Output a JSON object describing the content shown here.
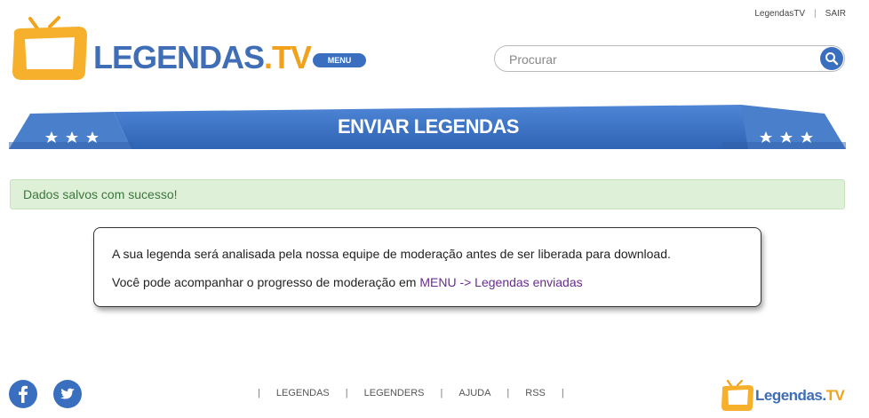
{
  "top_links": {
    "user": "LegendasTV",
    "logout": "SAIR"
  },
  "logo": {
    "main": "LEGENDAS",
    "dot": ".",
    "tv": "TV"
  },
  "menu_button": "MENU",
  "search": {
    "placeholder": "Procurar",
    "icon": "search-icon"
  },
  "banner": {
    "title": "ENVIAR LEGENDAS"
  },
  "alert": {
    "text": "Dados salvos com sucesso!"
  },
  "info": {
    "line1": "A sua legenda será analisada pela nossa equipe de moderação antes de ser liberada para download.",
    "line2_prefix": "Você pode acompanhar o progresso de moderação em ",
    "line2_link": "MENU -> Legendas enviadas"
  },
  "footer": {
    "nav": [
      "LEGENDAS",
      "LEGENDERS",
      "AJUDA",
      "RSS"
    ],
    "social": [
      "facebook-icon",
      "twitter-icon"
    ],
    "logo_main": "Legendas.",
    "logo_tv": "TV"
  },
  "colors": {
    "brand_blue": "#3a6fc0",
    "brand_orange": "#f0a21b",
    "success_bg": "#dff0d8",
    "success_text": "#3c763d",
    "link_purple": "#6a2c91"
  }
}
